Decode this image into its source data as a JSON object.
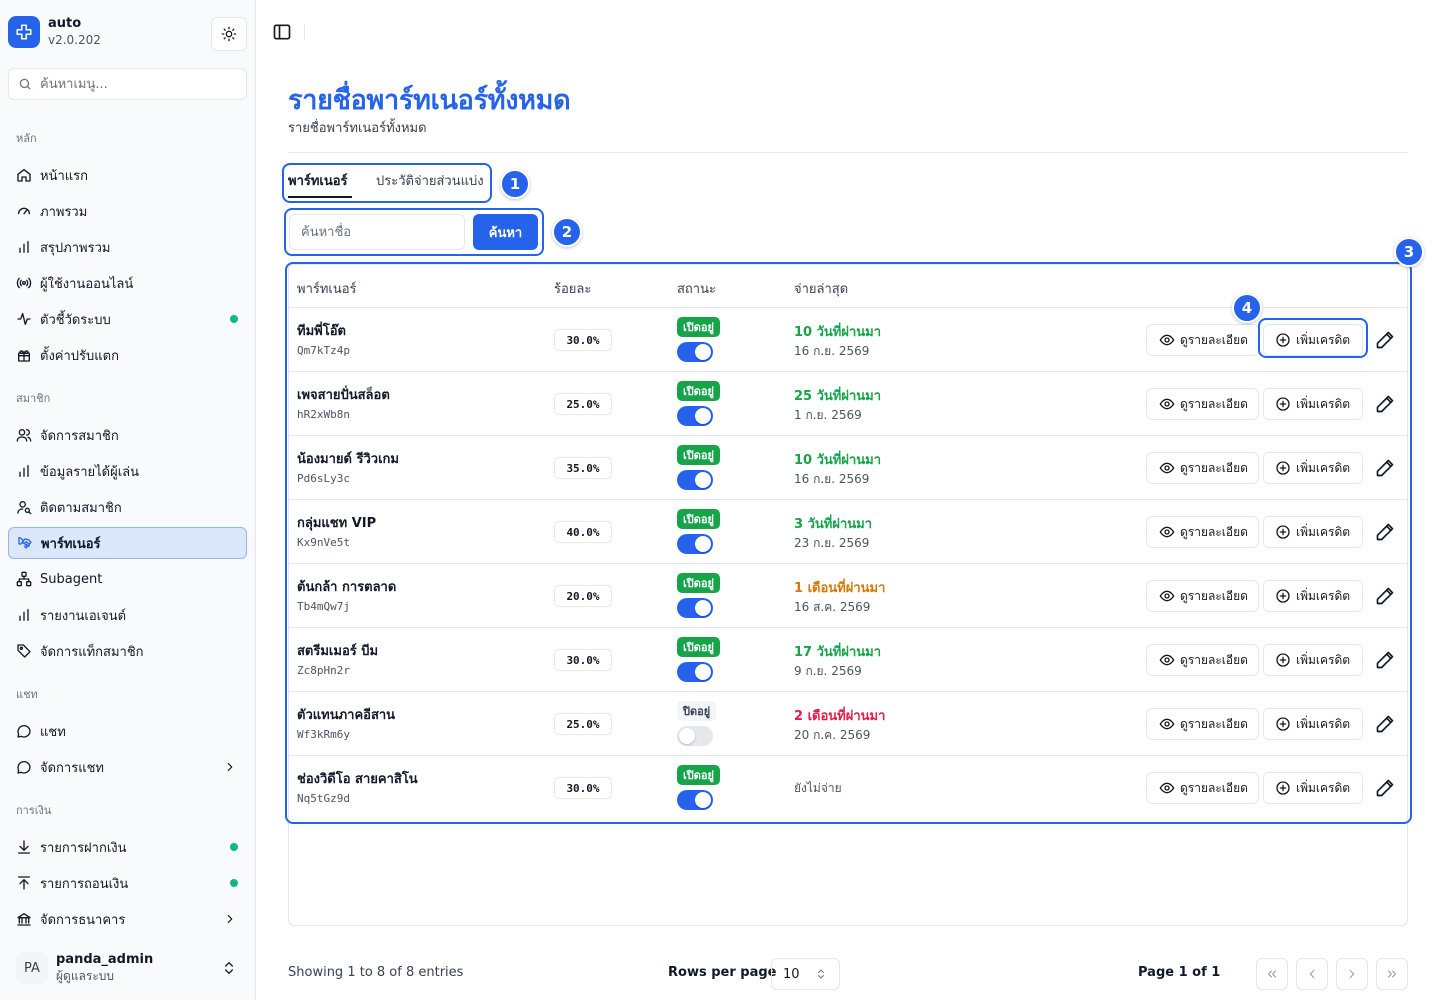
{
  "colors": {
    "accent": "#2563eb",
    "success": "#16a34a",
    "warning": "#d97706",
    "danger": "#e11d48",
    "dot": "#10b981"
  },
  "brand": {
    "name": "auto",
    "version": "v2.0.202"
  },
  "sidebar": {
    "search_placeholder": "ค้นหาเมนู...",
    "groups": [
      {
        "label": "หลัก",
        "items": [
          {
            "label": "หน้าแรก",
            "icon": "home-icon"
          },
          {
            "label": "ภาพรวม",
            "icon": "gauge-icon"
          },
          {
            "label": "สรุปภาพรวม",
            "icon": "bar-chart-icon"
          },
          {
            "label": "ผู้ใช้งานออนไลน์",
            "icon": "radio-icon"
          },
          {
            "label": "ตัวชี้วัดระบบ",
            "icon": "activity-icon",
            "status_dot": true
          },
          {
            "label": "ตั้งค่าปรับแตก",
            "icon": "gift-icon"
          }
        ]
      },
      {
        "label": "สมาชิก",
        "items": [
          {
            "label": "จัดการสมาชิก",
            "icon": "users-icon"
          },
          {
            "label": "ข้อมูลรายได้ผู้เล่น",
            "icon": "bar-chart-icon"
          },
          {
            "label": "ติดตามสมาชิก",
            "icon": "user-search-icon"
          },
          {
            "label": "พาร์ทเนอร์",
            "icon": "handshake-icon",
            "active": true
          },
          {
            "label": "Subagent",
            "icon": "network-icon"
          },
          {
            "label": "รายงานเอเจนต์",
            "icon": "bar-chart-icon"
          },
          {
            "label": "จัดการแท็กสมาชิก",
            "icon": "tag-icon"
          }
        ]
      },
      {
        "label": "แชท",
        "items": [
          {
            "label": "แชท",
            "icon": "chat-icon"
          },
          {
            "label": "จัดการแชท",
            "icon": "chat-icon",
            "chevron": true
          }
        ]
      },
      {
        "label": "การเงิน",
        "items": [
          {
            "label": "รายการฝากเงิน",
            "icon": "download-icon",
            "status_dot": true
          },
          {
            "label": "รายการถอนเงิน",
            "icon": "upload-icon",
            "status_dot": true
          },
          {
            "label": "จัดการธนาคาร",
            "icon": "bank-icon",
            "chevron": true
          }
        ]
      }
    ],
    "user": {
      "initials": "PA",
      "name": "panda_admin",
      "role": "ผู้ดูแลระบบ"
    }
  },
  "page": {
    "title": "รายชื่อพาร์ทเนอร์ทั้งหมด",
    "subtitle": "รายชื่อพาร์ทเนอร์ทั้งหมด"
  },
  "tabs": [
    {
      "label": "พาร์ทเนอร์",
      "active": true
    },
    {
      "label": "ประวัติจ่ายส่วนแบ่ง",
      "active": false
    }
  ],
  "search": {
    "placeholder": "ค้นหาชื่อ",
    "button": "ค้นหา"
  },
  "annotations": [
    "1",
    "2",
    "3",
    "4"
  ],
  "table": {
    "columns": [
      "พาร์ทเนอร์",
      "ร้อยละ",
      "สถานะ",
      "จ่ายล่าสุด"
    ],
    "view_label": "ดูรายละเอียด",
    "credit_label": "เพิ่มเครดิต",
    "rows": [
      {
        "name": "ทีมพี่โอ๊ต",
        "code": "Qm7kTz4p",
        "percent": "30.0%",
        "status": "เปิดอยู่",
        "enabled": true,
        "paid_relative": "10 วันที่ผ่านมา",
        "paid_date": "16 ก.ย. 2569",
        "tone": "success"
      },
      {
        "name": "เพจสายปั่นสล็อต",
        "code": "hR2xWb8n",
        "percent": "25.0%",
        "status": "เปิดอยู่",
        "enabled": true,
        "paid_relative": "25 วันที่ผ่านมา",
        "paid_date": "1 ก.ย. 2569",
        "tone": "success"
      },
      {
        "name": "น้องมายด์ รีวิวเกม",
        "code": "Pd6sLy3c",
        "percent": "35.0%",
        "status": "เปิดอยู่",
        "enabled": true,
        "paid_relative": "10 วันที่ผ่านมา",
        "paid_date": "16 ก.ย. 2569",
        "tone": "success"
      },
      {
        "name": "กลุ่มแชท VIP",
        "code": "Kx9nVe5t",
        "percent": "40.0%",
        "status": "เปิดอยู่",
        "enabled": true,
        "paid_relative": "3 วันที่ผ่านมา",
        "paid_date": "23 ก.ย. 2569",
        "tone": "success"
      },
      {
        "name": "ต้นกล้า การตลาด",
        "code": "Tb4mQw7j",
        "percent": "20.0%",
        "status": "เปิดอยู่",
        "enabled": true,
        "paid_relative": "1 เดือนที่ผ่านมา",
        "paid_date": "16 ส.ค. 2569",
        "tone": "warning"
      },
      {
        "name": "สตรีมเมอร์ บีม",
        "code": "Zc8pHn2r",
        "percent": "30.0%",
        "status": "เปิดอยู่",
        "enabled": true,
        "paid_relative": "17 วันที่ผ่านมา",
        "paid_date": "9 ก.ย. 2569",
        "tone": "success"
      },
      {
        "name": "ตัวแทนภาคอีสาน",
        "code": "Wf3kRm6y",
        "percent": "25.0%",
        "status": "ปิดอยู่",
        "enabled": false,
        "paid_relative": "2 เดือนที่ผ่านมา",
        "paid_date": "20 ก.ค. 2569",
        "tone": "danger"
      },
      {
        "name": "ช่องวิดีโอ สายคาสิโน",
        "code": "Nq5tGz9d",
        "percent": "30.0%",
        "status": "เปิดอยู่",
        "enabled": true,
        "paid_relative": "",
        "paid_date": "",
        "paid_none": "ยังไม่จ่าย",
        "tone": "none"
      }
    ]
  },
  "footer": {
    "showing": "Showing 1 to 8 of 8 entries",
    "rows_per_page_label": "Rows per page",
    "rows_per_page": "10",
    "page_info": "Page 1 of 1"
  }
}
